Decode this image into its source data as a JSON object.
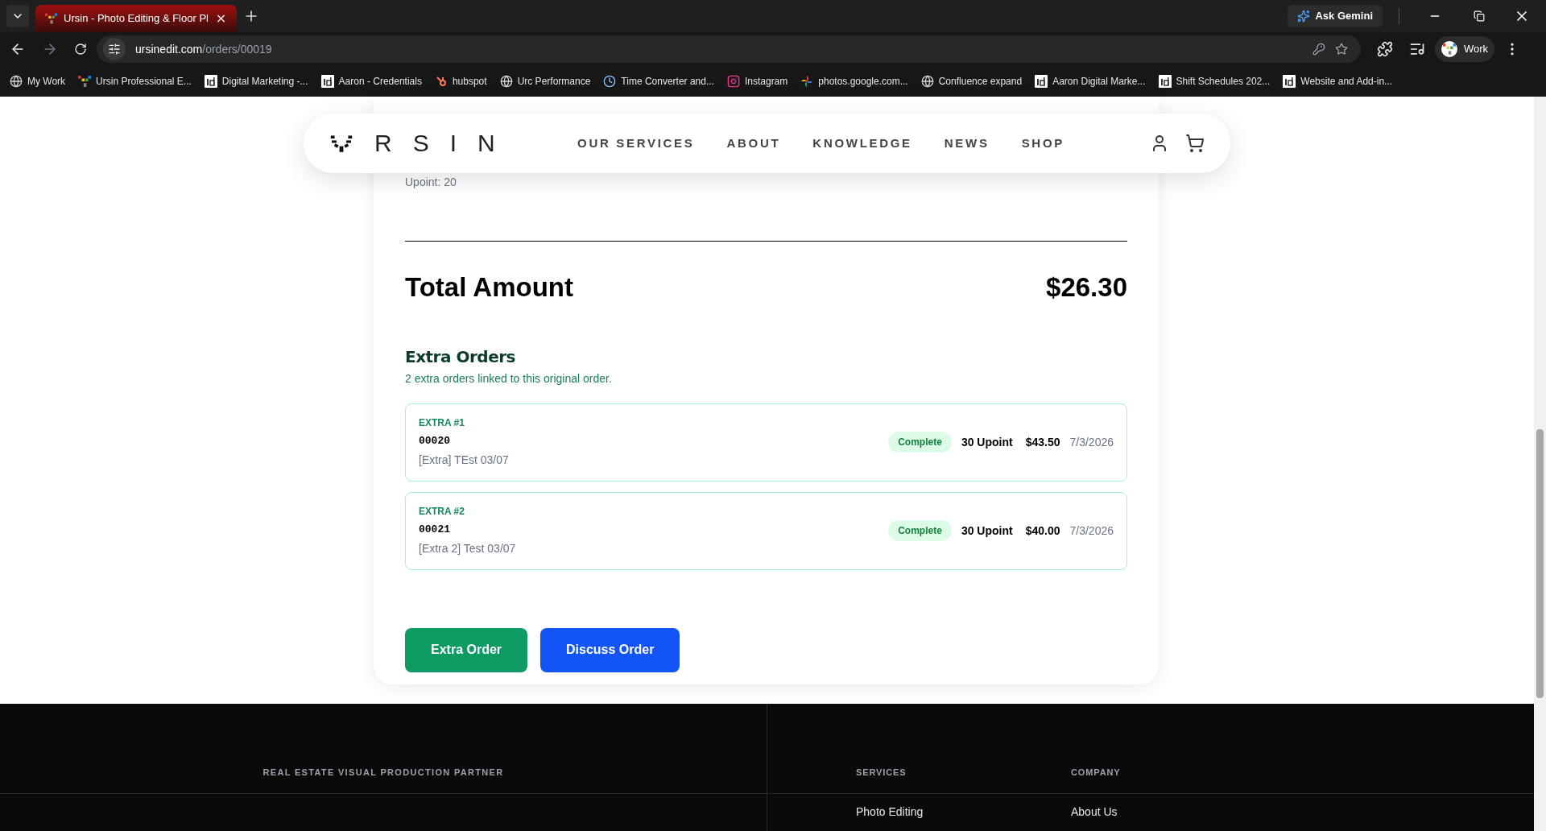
{
  "browser": {
    "tab_title": "Ursin - Photo Editing & Floor Pl",
    "ask_button": "Ask Gemini",
    "url_host": "ursinedit.com",
    "url_path": "/orders/00019",
    "profile": "Work",
    "bookmarks": [
      {
        "label": "My Work",
        "kind": "globe"
      },
      {
        "label": "Ursin Professional E...",
        "kind": "logo"
      },
      {
        "label": "Digital Marketing -...",
        "kind": "id"
      },
      {
        "label": "Aaron - Credentials",
        "kind": "id"
      },
      {
        "label": "hubspot",
        "kind": "hubspot"
      },
      {
        "label": "Urc Performance",
        "kind": "globe"
      },
      {
        "label": "Time Converter and...",
        "kind": "clock"
      },
      {
        "label": "Instagram",
        "kind": "instagram"
      },
      {
        "label": "photos.google.com...",
        "kind": "pinwheel"
      },
      {
        "label": "Confluence expand",
        "kind": "globe"
      },
      {
        "label": "Aaron Digital Marke...",
        "kind": "id"
      },
      {
        "label": "Shift Schedules 202...",
        "kind": "id"
      },
      {
        "label": "Website and Add-in...",
        "kind": "id"
      }
    ]
  },
  "nav": {
    "logo_letters": [
      "R",
      "S",
      "I",
      "N"
    ],
    "links": [
      "OUR SERVICES",
      "ABOUT",
      "KNOWLEDGE",
      "NEWS",
      "SHOP"
    ]
  },
  "order": {
    "upoint_line": "Upoint: 20",
    "total_label": "Total Amount",
    "total_value": "$26.30",
    "extra_title": "Extra Orders",
    "extra_subtitle": "2 extra orders linked to this original order.",
    "extras": [
      {
        "label": "EXTRA #1",
        "number": "00020",
        "name": "[Extra] TEst 03/07",
        "status": "Complete",
        "upoint": "30 Upoint",
        "price": "$43.50",
        "date": "7/3/2026"
      },
      {
        "label": "EXTRA #2",
        "number": "00021",
        "name": "[Extra 2] Test 03/07",
        "status": "Complete",
        "upoint": "30 Upoint",
        "price": "$40.00",
        "date": "7/3/2026"
      }
    ],
    "buttons": [
      {
        "label": "Extra Order",
        "kind": "green"
      },
      {
        "label": "Discuss Order",
        "kind": "blue"
      }
    ]
  },
  "footer": {
    "tagline": "REAL ESTATE VISUAL PRODUCTION PARTNER",
    "columns": [
      {
        "heading": "SERVICES",
        "links": [
          "Photo Editing"
        ]
      },
      {
        "heading": "COMPANY",
        "links": [
          "About Us"
        ]
      }
    ]
  }
}
